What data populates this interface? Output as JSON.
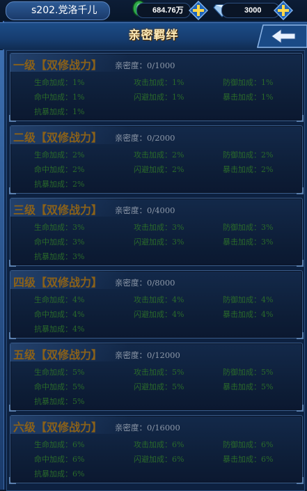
{
  "top_bar": {
    "player_name": "s202.党洛千儿",
    "jade_amount": "684.76万",
    "diamond_amount": "3000",
    "icons": [
      "jade-icon",
      "diamond-icon",
      "plus-icon"
    ]
  },
  "header": {
    "title": "亲密羁绊",
    "back_icon": "back-arrow-icon"
  },
  "colors": {
    "title_gold": "#8a6119",
    "stat_green": "#2a6a2a",
    "panel_blue": "#123059"
  },
  "levels": [
    {
      "title": "一级【双修战力】",
      "intimacy": "亲密度：0/1000",
      "stats": [
        "生命加成：1%",
        "攻击加成：1%",
        "防御加成：1%",
        "命中加成：1%",
        "闪避加成：1%",
        "暴击加成：1%",
        "抗暴加成：1%"
      ]
    },
    {
      "title": "二级【双修战力】",
      "intimacy": "亲密度：0/2000",
      "stats": [
        "生命加成：2%",
        "攻击加成：2%",
        "防御加成：2%",
        "命中加成：2%",
        "闪避加成：2%",
        "暴击加成：2%",
        "抗暴加成：2%"
      ]
    },
    {
      "title": "三级【双修战力】",
      "intimacy": "亲密度：0/4000",
      "stats": [
        "生命加成：3%",
        "攻击加成：3%",
        "防御加成：3%",
        "命中加成：3%",
        "闪避加成：3%",
        "暴击加成：3%",
        "抗暴加成：3%"
      ]
    },
    {
      "title": "四级【双修战力】",
      "intimacy": "亲密度：0/8000",
      "stats": [
        "生命加成：4%",
        "攻击加成：4%",
        "防御加成：4%",
        "命中加成：4%",
        "闪避加成：4%",
        "暴击加成：4%",
        "抗暴加成：4%"
      ]
    },
    {
      "title": "五级【双修战力】",
      "intimacy": "亲密度：0/12000",
      "stats": [
        "生命加成：5%",
        "攻击加成：5%",
        "防御加成：5%",
        "命中加成：5%",
        "闪避加成：5%",
        "暴击加成：5%",
        "抗暴加成：5%"
      ]
    },
    {
      "title": "六级【双修战力】",
      "intimacy": "亲密度：0/16000",
      "stats": [
        "生命加成：6%",
        "攻击加成：6%",
        "防御加成：6%",
        "命中加成：6%",
        "闪避加成：6%",
        "暴击加成：6%",
        "抗暴加成：6%"
      ]
    }
  ]
}
